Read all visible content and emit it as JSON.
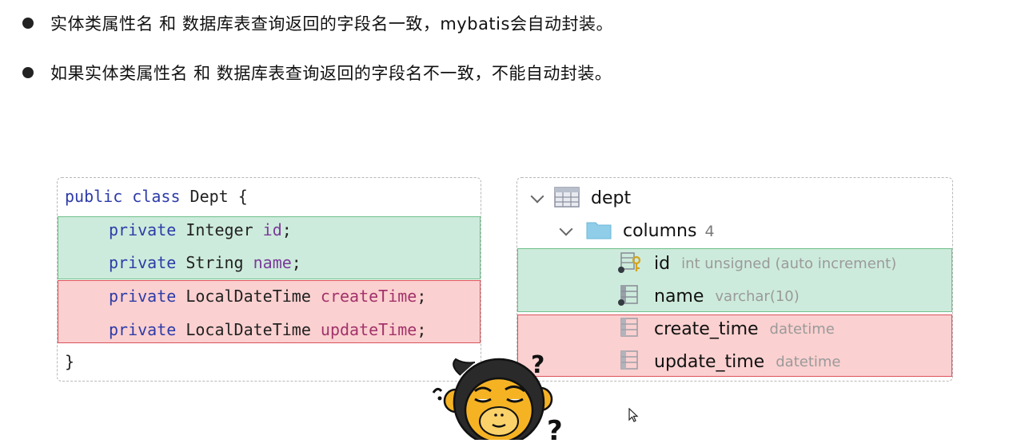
{
  "bullets": [
    "实体类属性名 和 数据库表查询返回的字段名一致，mybatis会自动封装。",
    "如果实体类属性名 和 数据库表查询返回的字段名不一致，不能自动封装。"
  ],
  "code": {
    "line1": {
      "kw": "public class",
      "rest": " Dept {"
    },
    "line2": {
      "kw": "private",
      "type": " Integer ",
      "field": "id",
      "end": ";"
    },
    "line3": {
      "kw": "private",
      "type": " String ",
      "field": "name",
      "end": ";"
    },
    "line4": {
      "kw": "private",
      "type": " LocalDateTime ",
      "field": "createTime",
      "end": ";"
    },
    "line5": {
      "kw": "private",
      "type": " LocalDateTime ",
      "field": "updateTime",
      "end": ";"
    },
    "line6": "}"
  },
  "db": {
    "table": "dept",
    "columns_label": "columns",
    "columns_count": "4",
    "columns": [
      {
        "name": "id",
        "type": "int unsigned (auto increment)"
      },
      {
        "name": "name",
        "type": "varchar(10)"
      },
      {
        "name": "create_time",
        "type": "datetime"
      },
      {
        "name": "update_time",
        "type": "datetime"
      }
    ]
  },
  "icons": {
    "table": "table-icon",
    "folder": "folder-icon",
    "key_column": "key-column-icon",
    "column": "column-icon",
    "monkey": "confused-monkey-icon",
    "cursor": "mouse-cursor-icon"
  },
  "colors": {
    "match_bg": "#cdebdc",
    "match_border": "#6fbf8a",
    "mismatch_bg": "#fbd0d0",
    "mismatch_border": "#d9535a"
  }
}
